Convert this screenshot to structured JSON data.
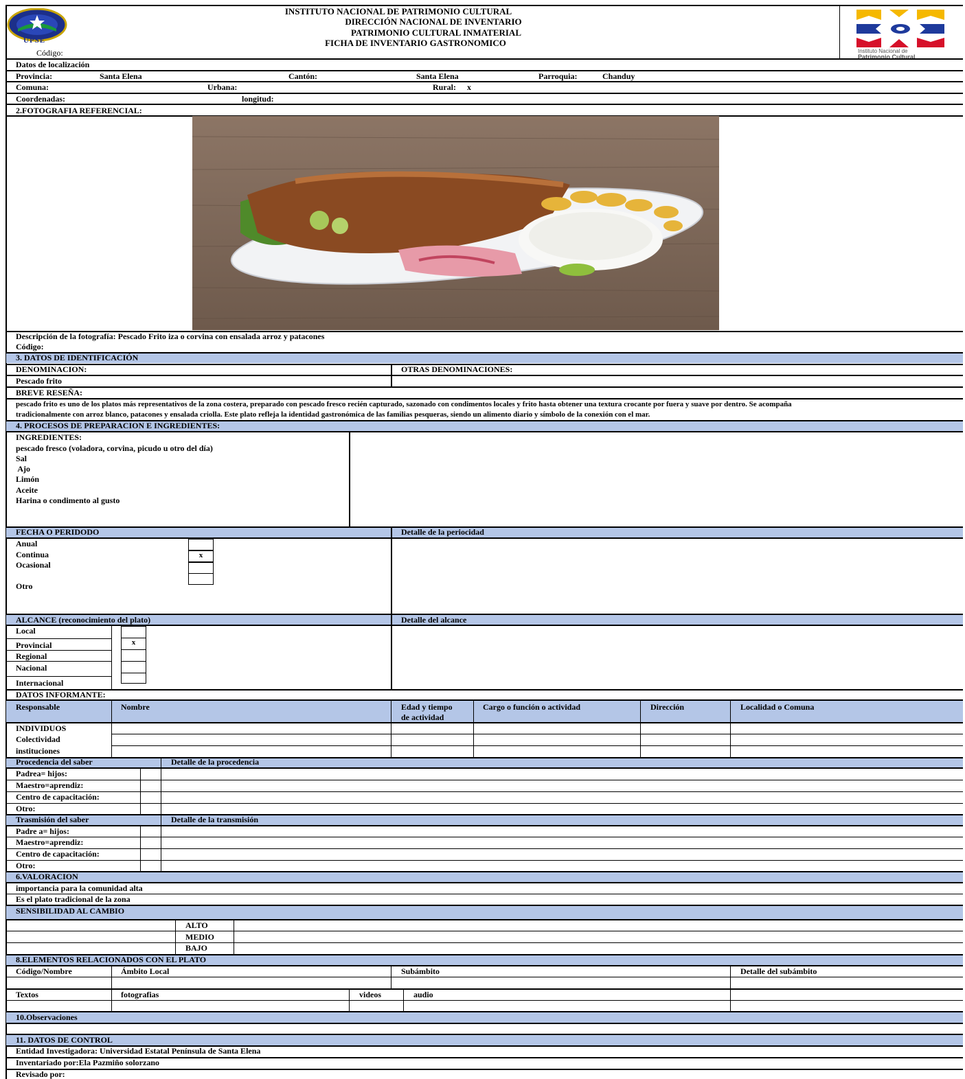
{
  "header": {
    "line1": "INSTITUTO NACIONAL DE PATRIMONIO CULTURAL",
    "line2": "DIRECCIÓN NACIONAL DE INVENTARIO",
    "line3": "PATRIMONIO CULTURAL INMATERIAL",
    "line4": "FICHA DE INVENTARIO GASTRONOMICO",
    "codigo_label": "Código:",
    "left_logo_text": "UPSE",
    "right_logo_text_1": "Instituto Nacional de",
    "right_logo_text_2": "Patrimonio Cultural"
  },
  "localizacion": {
    "title": "Datos de localización",
    "provincia_label": "Provincia:",
    "provincia": "Santa Elena",
    "canton_label": "Cantón:",
    "canton": "Santa Elena",
    "parroquia_label": "Parroquia:",
    "parroquia": "Chanduy",
    "comuna_label": "Comuna:",
    "urbana_label": "Urbana:",
    "rural_label": "Rural:",
    "rural_mark": "x",
    "coordenadas_label": "Coordenadas:",
    "longitud_label": "longitud:"
  },
  "fotografia": {
    "title": "2.FOTOGRAFIA REFERENCIAL:",
    "descripcion": "Descripción de la fotografía: Pescado Frito iza o corvina con ensalada arroz y patacones",
    "codigo_label": "Código:"
  },
  "identificacion": {
    "title": "3. DATOS DE IDENTIFICACIÓN",
    "denominacion_label": "DENOMINACION:",
    "otras_label": "OTRAS DENOMINACIONES:",
    "denominacion": "Pescado frito",
    "resena_label": "BREVE RESEÑA:",
    "resena_1": "pescado frito es uno de los platos más representativos de la zona costera, preparado con pescado fresco recién capturado, sazonado con condimentos locales y frito hasta obtener una textura crocante por fuera y suave por dentro. Se acompaña",
    "resena_2": "tradicionalmente con arroz blanco, patacones y ensalada criolla. Este plato refleja la identidad gastronómica de las familias pesqueras, siendo un alimento diario y símbolo de la conexión con el mar."
  },
  "procesos": {
    "title": "4. PROCESOS DE PREPARACION E INGREDIENTES:",
    "ingredientes_label": "INGREDIENTES:",
    "ingredientes": [
      "pescado fresco (voladora, corvina, picudo u otro del día)",
      "Sal",
      " Ajo",
      "Limón",
      "Aceite",
      "Harina o condimento al gusto"
    ]
  },
  "periodo": {
    "title": "FECHA O PERIDODO",
    "detalle_label": "Detalle de la periocidad",
    "items": [
      "Anual",
      "Continua",
      "Ocasional",
      "Otro"
    ],
    "marks": [
      "",
      "x",
      "",
      ""
    ]
  },
  "alcance": {
    "title": "ALCANCE (reconocimiento del plato)",
    "detalle_label": "Detalle del alcance",
    "items": [
      "Local",
      "Provincial",
      "Regional",
      "Nacional",
      "Internacional"
    ],
    "marks": [
      "",
      "x",
      "",
      "",
      ""
    ]
  },
  "informante": {
    "title": "DATOS INFORMANTE:",
    "headers": [
      "Responsable",
      "Nombre",
      "Edad y tiempo",
      "de actividad",
      "Cargo o función o actividad",
      "Dirección",
      "Localidad o Comuna"
    ],
    "rows": [
      "INDIVIDUOS",
      "Colectividad",
      "instituciones"
    ]
  },
  "procedencia": {
    "title": "Procedencia del saber",
    "detalle_label": "Detalle de la procedencia",
    "rows": [
      "Padrea= hijos:",
      "Maestro=aprendiz:",
      "Centro de capacitación:",
      "Otro:"
    ]
  },
  "transmision": {
    "title": "Trasmisión del saber",
    "detalle_label": "Detalle de la transmisión",
    "rows": [
      "Padre a= hijos:",
      "Maestro=aprendiz:",
      "Centro de capacitación:",
      "Otro:"
    ]
  },
  "valoracion": {
    "title": "6.VALORACION",
    "line1": "importancia para la comunidad alta",
    "line2": "Es el plato tradicional de la zona"
  },
  "sensibilidad": {
    "title": "SENSIBILIDAD AL CAMBIO",
    "levels": [
      "ALTO",
      "MEDIO",
      "BAJO"
    ]
  },
  "elementos": {
    "title": "8.ELEMENTOS RELACIONADOS CON EL PLATO",
    "headers": [
      "Código/Nombre",
      "Ámbito Local",
      "Subámbito",
      "Detalle del subámbito"
    ],
    "media": [
      "Textos",
      "fotografias",
      "videos",
      "audio"
    ]
  },
  "observaciones": {
    "title": "10.Observaciones"
  },
  "control": {
    "title": "11. DATOS DE CONTROL",
    "entidad": "Entidad Investigadora: Universidad Estatal Península de Santa Elena",
    "inventariado": "Inventariado por:Ela Pazmiño solorzano",
    "revisado": "Revisado por:"
  },
  "colors": {
    "band": "#b4c6e7",
    "inpc_yellow": "#f5b800",
    "inpc_blue": "#1e3a9c",
    "inpc_red": "#d6102a"
  }
}
